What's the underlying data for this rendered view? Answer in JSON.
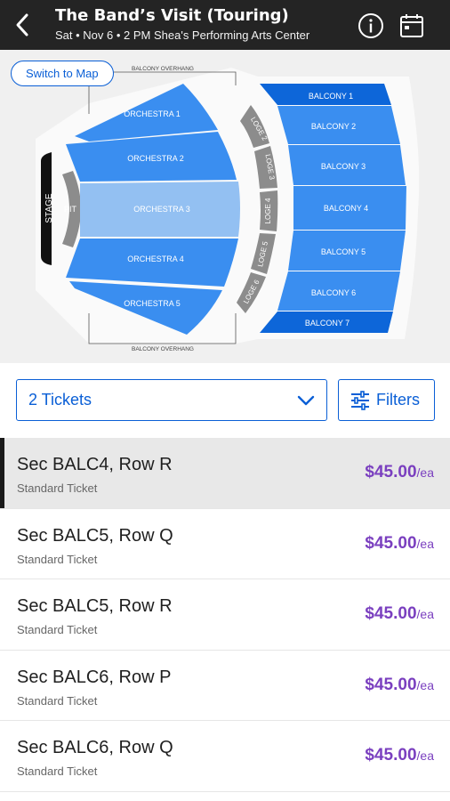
{
  "header": {
    "title": "The Band’s Visit (Touring)",
    "subtitle": "Sat • Nov 6 • 2 PM Shea's Performing Arts Center",
    "back_icon": "chevron-left-icon",
    "info_icon": "info-icon",
    "calendar_icon": "calendar-icon",
    "bg_color": "#242424"
  },
  "map": {
    "switch_label": "Switch to Map",
    "stage": "STAGE",
    "pit": "PIT",
    "overhang_top": "BALCONY OVERHANG",
    "overhang_bottom": "BALCONY OVERHANG",
    "orchestra": [
      "ORCHESTRA 1",
      "ORCHESTRA 2",
      "ORCHESTRA 3",
      "ORCHESTRA 4",
      "ORCHESTRA 5"
    ],
    "loge": [
      "LOGE 2",
      "LOGE 3",
      "LOGE 4",
      "LOGE 5",
      "LOGE 6"
    ],
    "balcony": [
      "BALCONY 1",
      "BALCONY 2",
      "BALCONY 3",
      "BALCONY 4",
      "BALCONY 5",
      "BALCONY 6",
      "BALCONY 7"
    ],
    "colors": {
      "section": "#3a8ef0",
      "section_dark": "#0d66d9",
      "section_light": "#93c0f2",
      "loge": "#8c8c8c"
    }
  },
  "controls": {
    "quantity": "2 Tickets",
    "filters_label": "Filters",
    "chevron_icon": "chevron-down-icon",
    "filters_icon": "sliders-icon"
  },
  "listings": [
    {
      "section": "Sec BALC4, Row R",
      "type": "Standard Ticket",
      "price": "$45.00",
      "unit": "/ea",
      "selected": true
    },
    {
      "section": "Sec BALC5, Row Q",
      "type": "Standard Ticket",
      "price": "$45.00",
      "unit": "/ea",
      "selected": false
    },
    {
      "section": "Sec BALC5, Row R",
      "type": "Standard Ticket",
      "price": "$45.00",
      "unit": "/ea",
      "selected": false
    },
    {
      "section": "Sec BALC6, Row P",
      "type": "Standard Ticket",
      "price": "$45.00",
      "unit": "/ea",
      "selected": false
    },
    {
      "section": "Sec BALC6, Row Q",
      "type": "Standard Ticket",
      "price": "$45.00",
      "unit": "/ea",
      "selected": false
    }
  ],
  "accent_color": "#0a5fd6",
  "price_color": "#7a3fbf"
}
